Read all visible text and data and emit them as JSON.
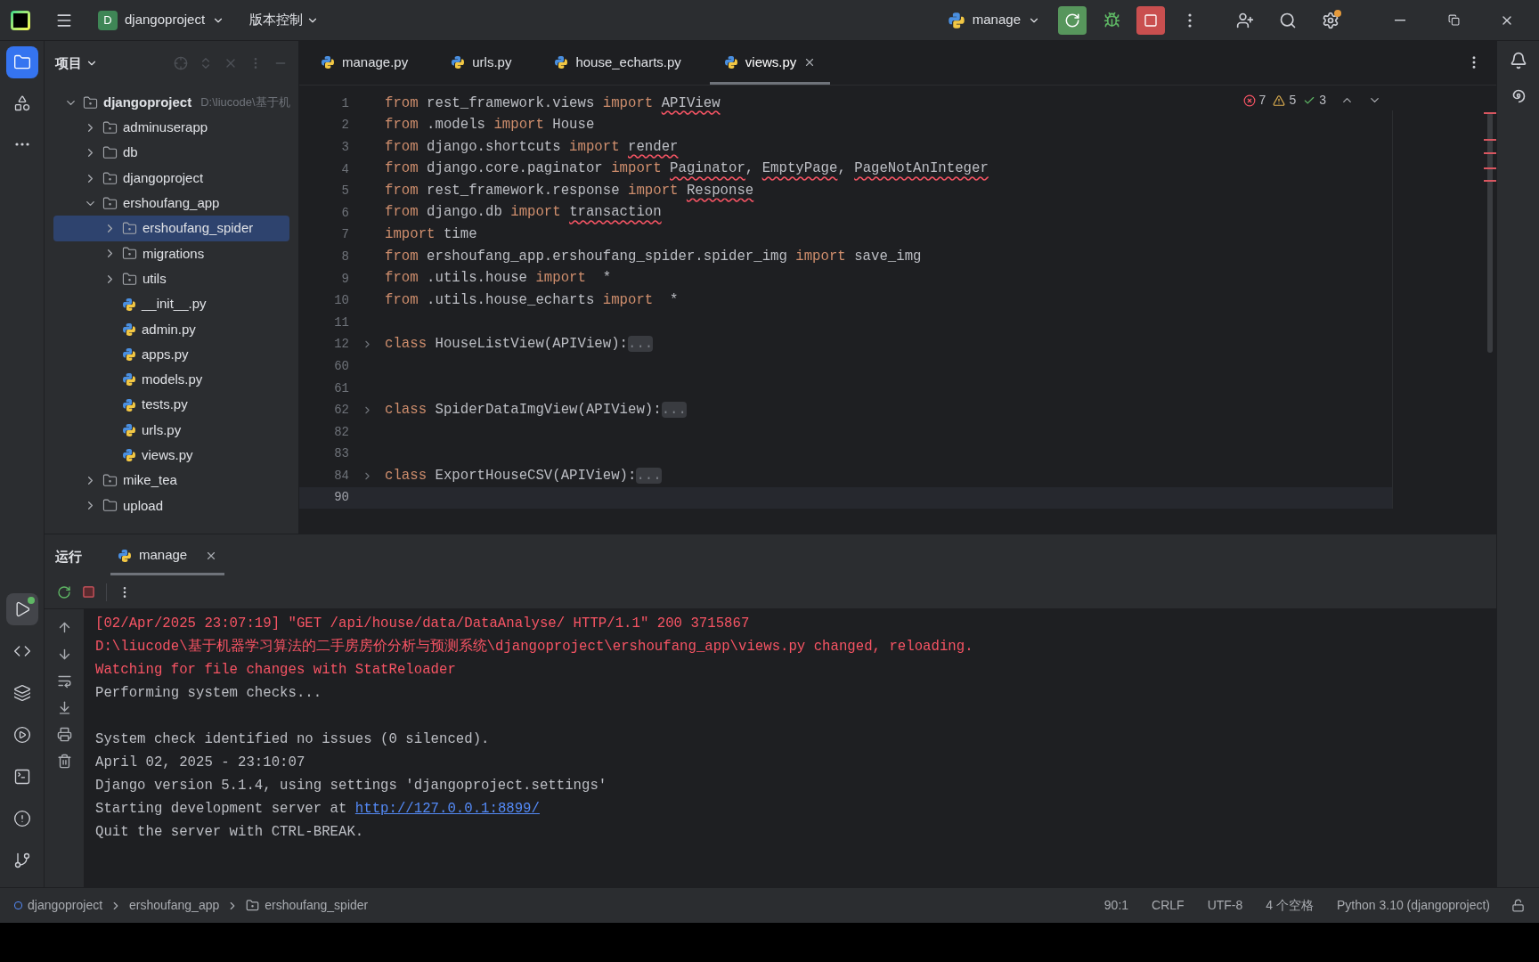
{
  "title_bar": {
    "project_badge": "D",
    "project": "djangoproject",
    "vcs": "版本控制",
    "run_config": "manage"
  },
  "left_tools": [
    {
      "kind": "project",
      "selected": true
    },
    {
      "kind": "structure",
      "selected": false
    },
    {
      "kind": "more",
      "selected": false
    }
  ],
  "bottom_tools": [
    {
      "kind": "run",
      "selected": true
    },
    {
      "kind": "python",
      "selected": false
    },
    {
      "kind": "layers",
      "selected": false
    },
    {
      "kind": "services",
      "selected": false
    },
    {
      "kind": "terminal",
      "selected": false
    },
    {
      "kind": "problems",
      "selected": false
    },
    {
      "kind": "git",
      "selected": false
    }
  ],
  "project_panel": {
    "title": "项目",
    "tree": [
      {
        "label": "djangoproject",
        "hint": "D:\\liucode\\基于机",
        "kind": "module",
        "bold": true,
        "expanded": true,
        "selected": false,
        "children": [
          {
            "label": "adminuserapp",
            "kind": "module",
            "expanded": false,
            "selected": false
          },
          {
            "label": "db",
            "kind": "folder",
            "expanded": false,
            "selected": false
          },
          {
            "label": "djangoproject",
            "kind": "module",
            "expanded": false,
            "selected": false
          },
          {
            "label": "ershoufang_app",
            "kind": "module",
            "expanded": true,
            "selected": false,
            "children": [
              {
                "label": "ershoufang_spider",
                "kind": "module",
                "expanded": false,
                "selected": true
              },
              {
                "label": "migrations",
                "kind": "module",
                "expanded": false,
                "selected": false
              },
              {
                "label": "utils",
                "kind": "module",
                "expanded": false,
                "selected": false
              },
              {
                "label": "__init__.py",
                "kind": "python",
                "selected": false
              },
              {
                "label": "admin.py",
                "kind": "python",
                "selected": false
              },
              {
                "label": "apps.py",
                "kind": "python",
                "selected": false
              },
              {
                "label": "models.py",
                "kind": "python",
                "selected": false
              },
              {
                "label": "tests.py",
                "kind": "python",
                "selected": false
              },
              {
                "label": "urls.py",
                "kind": "python",
                "selected": false
              },
              {
                "label": "views.py",
                "kind": "python",
                "selected": false
              }
            ]
          },
          {
            "label": "mike_tea",
            "kind": "module",
            "expanded": false,
            "selected": false
          },
          {
            "label": "upload",
            "kind": "folder",
            "expanded": false,
            "selected": false
          }
        ]
      }
    ]
  },
  "editor_tabs": [
    {
      "label": "manage.py",
      "selected": false
    },
    {
      "label": "urls.py",
      "selected": false
    },
    {
      "label": "house_echarts.py",
      "selected": false
    },
    {
      "label": "views.py",
      "selected": true,
      "closable": true
    }
  ],
  "inspections": {
    "errors": "7",
    "warnings": "5",
    "weak": "3"
  },
  "code": [
    {
      "number": "1",
      "tokens": [
        {
          "kind": "keyword",
          "text": "from"
        },
        {
          "kind": "plain",
          "text": " rest_framework.views "
        },
        {
          "kind": "keyword",
          "text": "import "
        },
        {
          "kind": "error",
          "text": "APIView"
        }
      ]
    },
    {
      "number": "2",
      "tokens": [
        {
          "kind": "keyword",
          "text": "from"
        },
        {
          "kind": "plain",
          "text": " .models "
        },
        {
          "kind": "keyword",
          "text": "import"
        },
        {
          "kind": "plain",
          "text": " House"
        }
      ]
    },
    {
      "number": "3",
      "tokens": [
        {
          "kind": "keyword",
          "text": "from"
        },
        {
          "kind": "plain",
          "text": " django.shortcuts "
        },
        {
          "kind": "keyword",
          "text": "import "
        },
        {
          "kind": "error",
          "text": "render"
        }
      ]
    },
    {
      "number": "4",
      "tokens": [
        {
          "kind": "keyword",
          "text": "from"
        },
        {
          "kind": "plain",
          "text": " django.core.paginator "
        },
        {
          "kind": "keyword",
          "text": "import "
        },
        {
          "kind": "error",
          "text": "Paginator"
        },
        {
          "kind": "plain",
          "text": ", "
        },
        {
          "kind": "error",
          "text": "EmptyPage"
        },
        {
          "kind": "plain",
          "text": ", "
        },
        {
          "kind": "error",
          "text": "PageNotAnInteger"
        }
      ]
    },
    {
      "number": "5",
      "tokens": [
        {
          "kind": "keyword",
          "text": "from"
        },
        {
          "kind": "plain",
          "text": " rest_framework.response "
        },
        {
          "kind": "keyword",
          "text": "import "
        },
        {
          "kind": "error",
          "text": "Response"
        }
      ]
    },
    {
      "number": "6",
      "tokens": [
        {
          "kind": "keyword",
          "text": "from"
        },
        {
          "kind": "plain",
          "text": " django.db "
        },
        {
          "kind": "keyword",
          "text": "import "
        },
        {
          "kind": "error",
          "text": "transaction"
        }
      ]
    },
    {
      "number": "7",
      "tokens": [
        {
          "kind": "keyword",
          "text": "import"
        },
        {
          "kind": "plain",
          "text": " time"
        }
      ]
    },
    {
      "number": "8",
      "tokens": [
        {
          "kind": "keyword",
          "text": "from"
        },
        {
          "kind": "plain",
          "text": " ershoufang_app.ershoufang_spider.spider_img "
        },
        {
          "kind": "keyword",
          "text": "import"
        },
        {
          "kind": "plain",
          "text": " save_img"
        }
      ]
    },
    {
      "number": "9",
      "tokens": [
        {
          "kind": "keyword",
          "text": "from"
        },
        {
          "kind": "plain",
          "text": " .utils.house "
        },
        {
          "kind": "keyword",
          "text": "import"
        },
        {
          "kind": "plain",
          "text": "  *"
        }
      ]
    },
    {
      "number": "10",
      "tokens": [
        {
          "kind": "keyword",
          "text": "from"
        },
        {
          "kind": "plain",
          "text": " .utils.house_echarts "
        },
        {
          "kind": "keyword",
          "text": "import"
        },
        {
          "kind": "plain",
          "text": "  *"
        }
      ]
    },
    {
      "number": "11"
    },
    {
      "number": "12",
      "foldable": true,
      "tokens": [
        {
          "kind": "keyword",
          "text": "class"
        },
        {
          "kind": "plain",
          "text": " HouseListView(APIView):"
        },
        {
          "kind": "fold",
          "text": "..."
        }
      ]
    },
    {
      "number": "60"
    },
    {
      "number": "61"
    },
    {
      "number": "62",
      "foldable": true,
      "tokens": [
        {
          "kind": "keyword",
          "text": "class"
        },
        {
          "kind": "plain",
          "text": " SpiderDataImgView(APIView):"
        },
        {
          "kind": "fold",
          "text": "..."
        }
      ]
    },
    {
      "number": "82"
    },
    {
      "number": "83"
    },
    {
      "number": "84",
      "foldable": true,
      "tokens": [
        {
          "kind": "keyword",
          "text": "class"
        },
        {
          "kind": "plain",
          "text": " ExportHouseCSV(APIView):"
        },
        {
          "kind": "fold",
          "text": "..."
        }
      ]
    },
    {
      "number": "90",
      "current": true
    }
  ],
  "run_panel": {
    "title": "运行",
    "tabs": [
      {
        "label": "manage",
        "selected": true
      }
    ],
    "console": [
      {
        "kind": "error",
        "text": "[02/Apr/2025 23:07:19] \"GET /api/house/data/DataAnalyse/ HTTP/1.1\" 200 3715867"
      },
      {
        "kind": "error",
        "text": "D:\\liucode\\基于机器学习算法的二手房房价分析与预测系统\\djangoproject\\ershoufang_app\\views.py changed, reloading."
      },
      {
        "kind": "error",
        "text": "Watching for file changes with StatReloader"
      },
      {
        "kind": "normal",
        "text": "Performing system checks..."
      },
      {
        "kind": "blank"
      },
      {
        "kind": "normal",
        "text": "System check identified no issues (0 silenced)."
      },
      {
        "kind": "normal",
        "text": "April 02, 2025 - 23:10:07"
      },
      {
        "kind": "normal",
        "text": "Django version 5.1.4, using settings 'djangoproject.settings'"
      },
      {
        "kind": "normal",
        "text": "Starting development server at ",
        "link": "http://127.0.0.1:8899/"
      },
      {
        "kind": "normal",
        "text": "Quit the server with CTRL-BREAK."
      }
    ]
  },
  "status_bar": {
    "breadcrumbs": [
      {
        "label": "djangoproject",
        "kind": "project"
      },
      {
        "label": "ershoufang_app",
        "kind": "plain"
      },
      {
        "label": "ershoufang_spider",
        "kind": "module"
      }
    ],
    "items": [
      "90:1",
      "CRLF",
      "UTF-8",
      "4 个空格",
      "Python 3.10 (djangoproject)"
    ]
  }
}
